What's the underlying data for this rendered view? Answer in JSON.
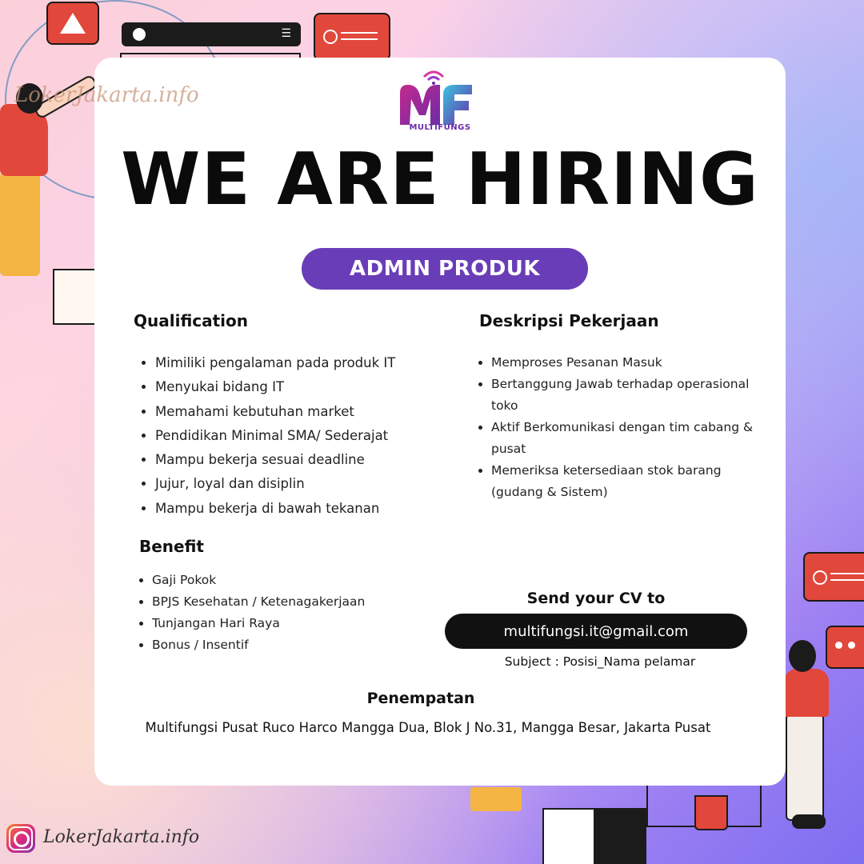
{
  "watermark": "LokerJakarta.info",
  "logo": {
    "text": "MULTIFUNGS"
  },
  "headline": "WE ARE HIRING",
  "position": "ADMIN PRODUK",
  "qualification": {
    "title": "Qualification",
    "items": [
      "Mimiliki pengalaman pada produk IT",
      "Menyukai bidang IT",
      "Memahami kebutuhan market",
      "Pendidikan Minimal SMA/ Sederajat",
      "Mampu bekerja sesuai deadline",
      "Jujur, loyal dan disiplin",
      "Mampu bekerja di bawah tekanan"
    ]
  },
  "description": {
    "title": "Deskripsi Pekerjaan",
    "items": [
      "Memproses Pesanan Masuk",
      "Bertanggung Jawab terhadap operasional toko",
      "Aktif Berkomunikasi dengan tim cabang & pusat",
      "Memeriksa ketersediaan stok barang (gudang & Sistem)"
    ]
  },
  "benefit": {
    "title": "Benefit",
    "items": [
      "Gaji Pokok",
      " BPJS Kesehatan / Ketenagakerjaan",
      "Tunjangan Hari Raya",
      "Bonus / Insentif"
    ]
  },
  "apply": {
    "title": "Send your CV to",
    "email": "multifungsi.it@gmail.com",
    "subject": "Subject : Posisi_Nama pelamar"
  },
  "placement": {
    "title": "Penempatan",
    "address": "Multifungsi Pusat Ruco Harco Mangga Dua, Blok J No.31, Mangga Besar, Jakarta Pusat"
  },
  "footer": {
    "text": "LokerJakarta.info",
    "icon": "instagram-icon"
  },
  "colors": {
    "accent": "#6a3db8",
    "email_bg": "#111111",
    "card": "#ffffff"
  }
}
